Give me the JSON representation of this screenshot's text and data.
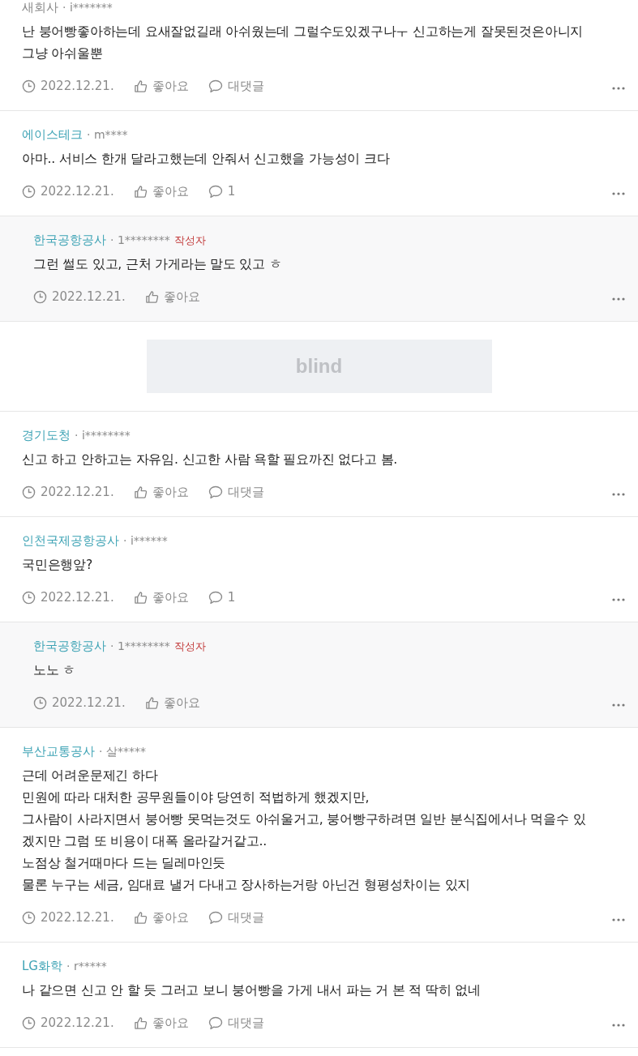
{
  "items": [
    {
      "kind": "comment",
      "company": "새회사",
      "verified": false,
      "user": "· i*******",
      "lines": [
        "난 붕어빵좋아하는데 요새잘없길래 아쉬웠는데 그럴수도있겠구나ㅜ 신고하는게 잘못된것은아니지",
        "그냥 아쉬울뿐"
      ],
      "date": "2022.12.21.",
      "like": "좋아요",
      "reply": "대댓글"
    },
    {
      "kind": "comment",
      "company": "에이스테크",
      "verified": true,
      "user": "· m****",
      "lines": [
        "아마.. 서비스 한개 달라고했는데 안줘서 신고했을 가능성이 크다"
      ],
      "date": "2022.12.21.",
      "like": "좋아요",
      "reply": "1"
    },
    {
      "kind": "reply",
      "company": "한국공항공사",
      "verified": true,
      "user": "· 1********",
      "badge": "작성자",
      "lines": [
        "그런 썰도 있고, 근처 가게라는 말도 있고 ㅎ"
      ],
      "date": "2022.12.21.",
      "like": "좋아요"
    },
    {
      "kind": "ad",
      "label": "blind"
    },
    {
      "kind": "comment",
      "company": "경기도청",
      "verified": true,
      "user": "· i********",
      "lines": [
        "신고 하고 안하고는 자유임. 신고한 사람 욕할 필요까진 없다고 봄."
      ],
      "date": "2022.12.21.",
      "like": "좋아요",
      "reply": "대댓글"
    },
    {
      "kind": "comment",
      "company": "인천국제공항공사",
      "verified": true,
      "user": "· i******",
      "lines": [
        "국민은행앞?"
      ],
      "date": "2022.12.21.",
      "like": "좋아요",
      "reply": "1"
    },
    {
      "kind": "reply",
      "company": "한국공항공사",
      "verified": true,
      "user": "· 1********",
      "badge": "작성자",
      "lines": [
        "노노 ㅎ"
      ],
      "date": "2022.12.21.",
      "like": "좋아요"
    },
    {
      "kind": "comment",
      "company": "부산교통공사",
      "verified": true,
      "user": "· 살*****",
      "lines": [
        "근데 어려운문제긴 하다",
        "민원에 따라 대처한 공무원들이야 당연히 적법하게 했겠지만,",
        "그사람이 사라지면서 붕어빵 못먹는것도 아쉬울거고, 붕어빵구하려면 일반 분식집에서나 먹을수 있",
        "겠지만 그럼 또 비용이 대폭 올라갈거같고..",
        "노점상 철거때마다 드는 딜레마인듯",
        "물론 누구는 세금, 임대료 낼거 다내고 장사하는거랑 아닌건 형평성차이는 있지"
      ],
      "date": "2022.12.21.",
      "like": "좋아요",
      "reply": "대댓글"
    },
    {
      "kind": "comment",
      "company": "LG화학",
      "verified": true,
      "user": "· r*****",
      "lines": [
        "나 같으면 신고 안 할 듯 그러고 보니 붕어빵을 가게 내서 파는 거 본 적 딱히 없네"
      ],
      "date": "2022.12.21.",
      "like": "좋아요",
      "reply": "대댓글"
    }
  ]
}
